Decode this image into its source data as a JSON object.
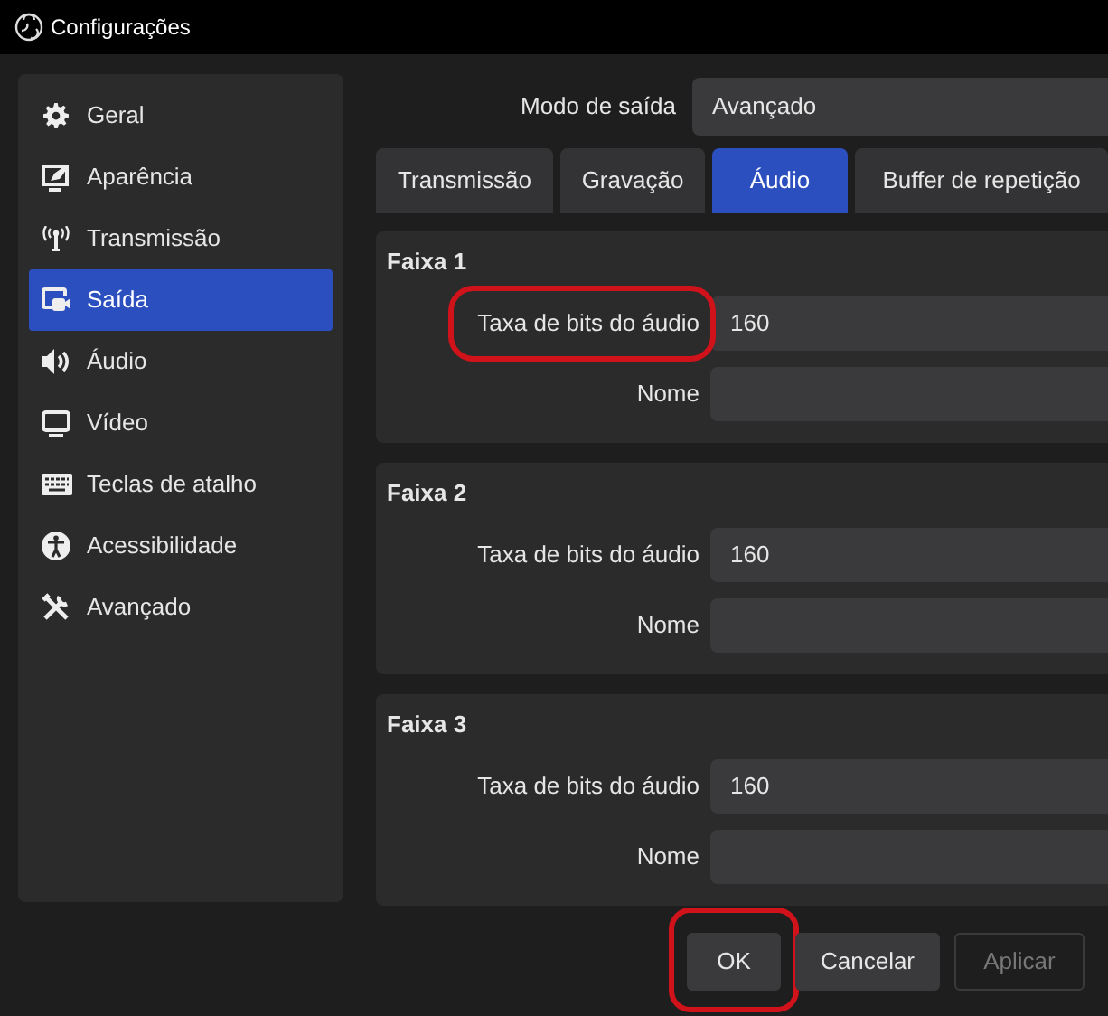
{
  "window": {
    "title": "Configurações"
  },
  "sidebar": {
    "items": [
      {
        "label": "Geral",
        "selected": false
      },
      {
        "label": "Aparência",
        "selected": false
      },
      {
        "label": "Transmissão",
        "selected": false
      },
      {
        "label": "Saída",
        "selected": true
      },
      {
        "label": "Áudio",
        "selected": false
      },
      {
        "label": "Vídeo",
        "selected": false
      },
      {
        "label": "Teclas de atalho",
        "selected": false
      },
      {
        "label": "Acessibilidade",
        "selected": false
      },
      {
        "label": "Avançado",
        "selected": false
      }
    ]
  },
  "output_mode": {
    "label": "Modo de saída",
    "value": "Avançado"
  },
  "tabs": [
    {
      "label": "Transmissão",
      "selected": false
    },
    {
      "label": "Gravação",
      "selected": false
    },
    {
      "label": "Áudio",
      "selected": true
    },
    {
      "label": "Buffer de repetição",
      "selected": false
    }
  ],
  "tracks": [
    {
      "title": "Faixa 1",
      "fields": [
        {
          "label": "Taxa de bits do áudio",
          "value": "160",
          "circled": true
        },
        {
          "label": "Nome",
          "circled": false
        }
      ]
    },
    {
      "title": "Faixa 2",
      "fields": [
        {
          "label": "Taxa de bits do áudio",
          "value": "160",
          "circled": false
        },
        {
          "label": "Nome",
          "circled": false
        }
      ]
    },
    {
      "title": "Faixa 3",
      "fields": [
        {
          "label": "Taxa de bits do áudio",
          "value": "160",
          "circled": false
        },
        {
          "label": "Nome",
          "circled": false
        }
      ]
    }
  ],
  "buttons": [
    {
      "label": "OK",
      "disabled": false,
      "circled": true
    },
    {
      "label": "Cancelar",
      "disabled": false,
      "circled": false
    },
    {
      "label": "Aplicar",
      "disabled": true,
      "circled": false
    }
  ]
}
